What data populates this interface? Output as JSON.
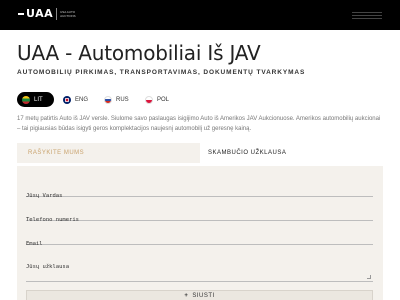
{
  "header": {
    "logo_text": "UAA",
    "logo_sub": "USA AUTO AUCTIONS",
    "menu_icon": "hamburger-icon"
  },
  "page": {
    "title": "UAA - Automobiliai Iš JAV",
    "subtitle": "AUTOMOBILIŲ PIRKIMAS, TRANSPORTAVIMAS, DOKUMENTŲ TVARKYMAS",
    "description": "17 metų patirtis Auto iš JAV versle. Siulome savo paslaugas isigijimo Auto iš Amerikos JAV Aukcionuose. Amerikos automobilių aukcionai – tai pigiausias būdas isigyti geros komplektacijos naujesnį automobilį už geresnę kainą."
  },
  "languages": [
    {
      "code": "LIT",
      "flag": "lithuania-flag-icon",
      "active": true
    },
    {
      "code": "ENG",
      "flag": "uk-flag-icon",
      "active": false
    },
    {
      "code": "RUS",
      "flag": "russia-flag-icon",
      "active": false
    },
    {
      "code": "POL",
      "flag": "poland-flag-icon",
      "active": false
    }
  ],
  "tabs": {
    "write": "RAŠYKITE MUMS",
    "call": "SKAMBUČIO UŽKLAUSA"
  },
  "form": {
    "name_label": "Jūsų Vardas",
    "phone_label": "Telefono numeris",
    "email_label": "Email",
    "message_label": "Jūsų užklausa",
    "submit_label": "SIUSTI"
  },
  "colors": {
    "accent": "#c9a26c",
    "form_bg": "#f4f1ec",
    "header_bg": "#000000"
  }
}
